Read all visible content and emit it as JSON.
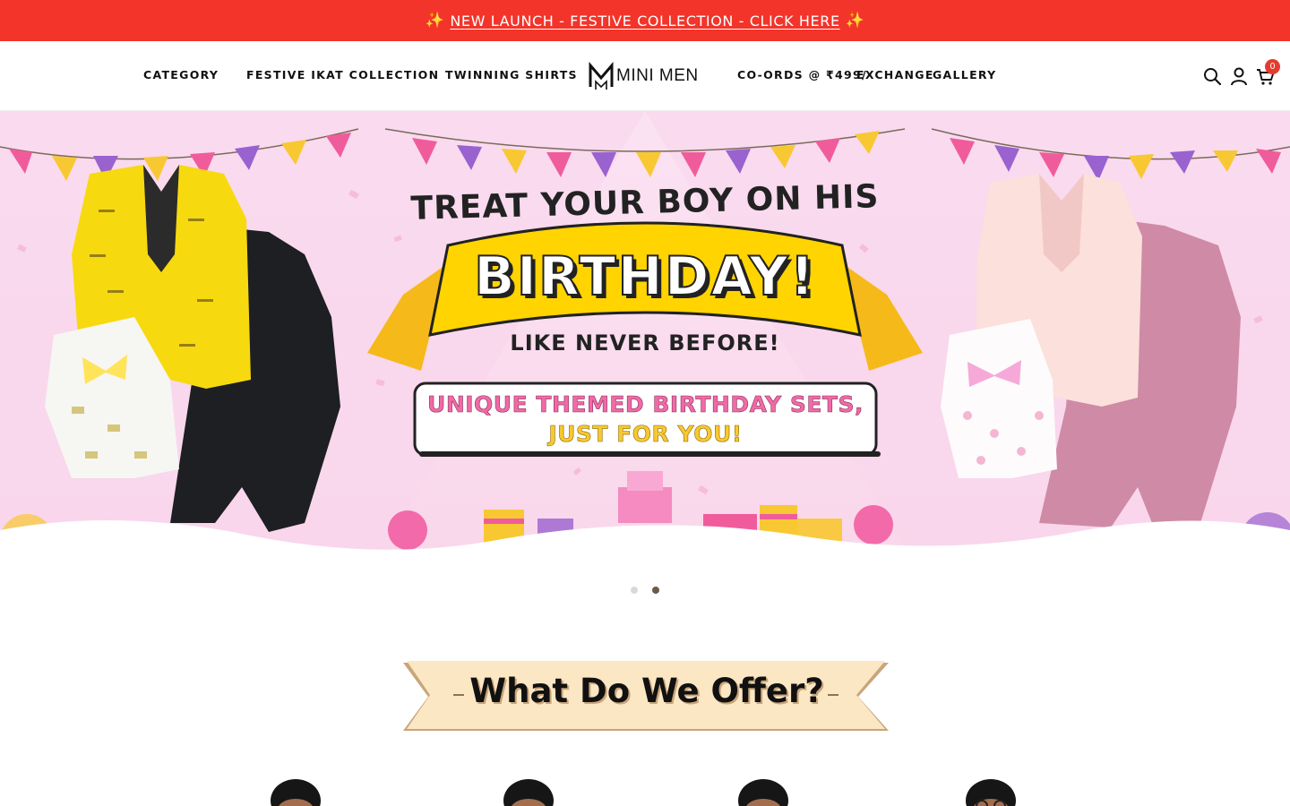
{
  "announcement": {
    "spark_left": "✨",
    "text": "NEW LAUNCH - FESTIVE COLLECTION - CLICK HERE",
    "spark_right": "✨"
  },
  "header": {
    "nav_left": [
      "CATEGORY",
      "FESTIVE IKAT COLLECTION",
      "TWINNING SHIRTS"
    ],
    "logo_text": "MINI MEN",
    "nav_right": [
      "CO-ORDS @ ₹499/-",
      "EXCHANGE",
      "GALLERY"
    ],
    "icons": [
      "search-icon",
      "account-icon",
      "cart-icon"
    ],
    "cart_count": "0"
  },
  "hero": {
    "line1": "TREAT YOUR BOY ON HIS",
    "line2": "BIRTHDAY!",
    "line3": "LIKE NEVER BEFORE!",
    "box_line1": "UNIQUE THEMED BIRTHDAY SETS,",
    "box_line2": "JUST FOR YOU!",
    "colors": {
      "background": "#fde6f3",
      "ribbon": "#ffd400",
      "pink_text": "#f06aa6"
    },
    "slides_total": 2,
    "active_slide": 2
  },
  "offer": {
    "title": "What Do We Offer?"
  }
}
